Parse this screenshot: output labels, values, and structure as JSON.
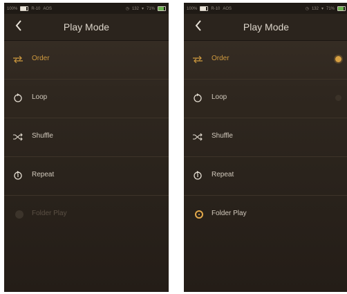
{
  "status_bar": {
    "left_battery_pct": "100%",
    "device": "R-10",
    "codec": "AOS",
    "volume": "132",
    "right_battery_pct": "71%"
  },
  "header": {
    "title": "Play Mode"
  },
  "left_screen": {
    "items": [
      {
        "label": "Order",
        "icon": "order-arrows-icon",
        "state": "active"
      },
      {
        "label": "Loop",
        "icon": "loop-icon",
        "state": "normal"
      },
      {
        "label": "Shuffle",
        "icon": "shuffle-icon",
        "state": "normal"
      },
      {
        "label": "Repeat",
        "icon": "repeat-icon",
        "state": "normal"
      },
      {
        "label": "Folder Play",
        "icon": "radio-unselected-icon",
        "state": "disabled"
      }
    ]
  },
  "right_screen": {
    "items": [
      {
        "label": "Order",
        "icon": "order-arrows-icon",
        "state": "active",
        "radio": "on"
      },
      {
        "label": "Loop",
        "icon": "loop-icon",
        "state": "normal",
        "radio": "off"
      },
      {
        "label": "Shuffle",
        "icon": "shuffle-icon",
        "state": "normal"
      },
      {
        "label": "Repeat",
        "icon": "repeat-icon",
        "state": "normal"
      },
      {
        "label": "Folder Play",
        "icon": "radio-selected-icon",
        "state": "normal"
      }
    ]
  },
  "colors": {
    "accent": "#cf9a3f",
    "background": "#2f271f",
    "text": "#d2cabd"
  }
}
